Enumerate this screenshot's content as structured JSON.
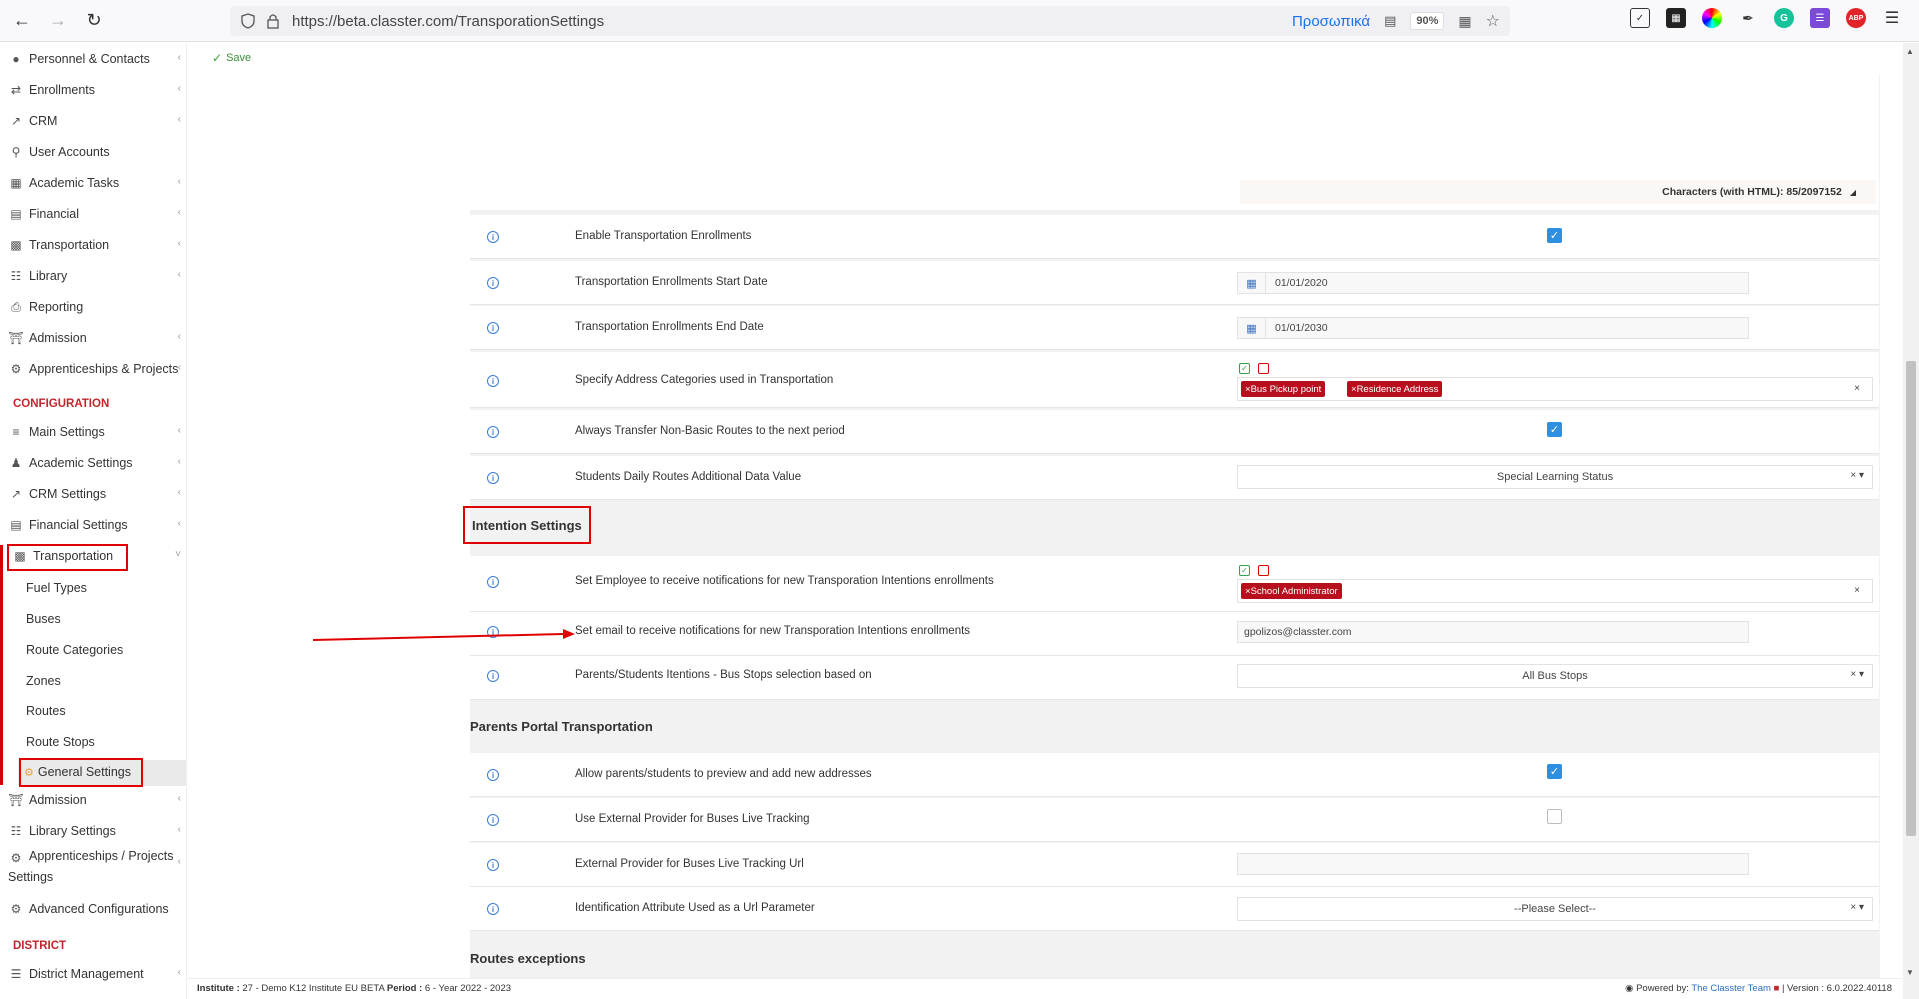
{
  "browser": {
    "url": "https://beta.classter.com/TransporationSettings",
    "profile_label": "Προσωπικά",
    "zoom": "90%"
  },
  "sidebar": {
    "items_top": [
      {
        "label": "Personnel & Contacts",
        "icon": "users-icon"
      },
      {
        "label": "Enrollments",
        "icon": "arrows-icon"
      },
      {
        "label": "CRM",
        "icon": "chart-icon"
      },
      {
        "label": "User Accounts",
        "icon": "key-icon"
      },
      {
        "label": "Academic Tasks",
        "icon": "grid-icon"
      },
      {
        "label": "Financial",
        "icon": "money-icon"
      },
      {
        "label": "Transportation",
        "icon": "bus-icon"
      },
      {
        "label": "Library",
        "icon": "books-icon"
      },
      {
        "label": "Reporting",
        "icon": "print-icon"
      },
      {
        "label": "Admission",
        "icon": "building-icon"
      },
      {
        "label": "Apprenticeships & Projects",
        "icon": "gear-icon"
      }
    ],
    "config_header": "CONFIGURATION",
    "items_config": [
      {
        "label": "Main Settings",
        "icon": "sliders-icon"
      },
      {
        "label": "Academic Settings",
        "icon": "people-icon"
      },
      {
        "label": "CRM Settings",
        "icon": "chart-icon"
      },
      {
        "label": "Financial Settings",
        "icon": "money-icon"
      }
    ],
    "transportation_label": "Transportation",
    "transport_sub": [
      "Fuel Types",
      "Buses",
      "Route Categories",
      "Zones",
      "Routes",
      "Route Stops"
    ],
    "general_settings": "General Settings",
    "items_after": [
      {
        "label": "Admission",
        "icon": "building-icon"
      },
      {
        "label": "Library Settings",
        "icon": "books-icon"
      }
    ],
    "apprenticeships_settings_line1": "Apprenticeships / Projects",
    "apprenticeships_settings_line2": "Settings",
    "advanced_config": "Advanced Configurations",
    "district_header": "DISTRICT",
    "district_mgmt": "District Management"
  },
  "toolbar": {
    "save_label": "Save"
  },
  "editor": {
    "char_counter": "Characters (with HTML): 85/2097152"
  },
  "rows": {
    "enable_enrollments": {
      "label": "Enable Transportation Enrollments",
      "checked": true
    },
    "start_date": {
      "label": "Transportation Enrollments Start Date",
      "value": "01/01/2020"
    },
    "end_date": {
      "label": "Transportation Enrollments End Date",
      "value": "01/01/2030"
    },
    "address_categories": {
      "label": "Specify Address Categories used in Transportation",
      "tags": [
        "Bus Pickup point",
        "Residence Address"
      ]
    },
    "transfer_routes": {
      "label": "Always Transfer Non-Basic Routes to the next period",
      "checked": true
    },
    "daily_routes_value": {
      "label": "Students Daily Routes Additional Data Value",
      "value": "Special Learning Status"
    }
  },
  "intention": {
    "title": "Intention Settings",
    "employee_notify": {
      "label": "Set Employee to receive notifications for new Transporation Intentions enrollments",
      "tags": [
        "School Administrator"
      ]
    },
    "email_notify": {
      "label": "Set email to receive notifications for new Transporation Intentions enrollments",
      "value": "gpolizos@classter.com"
    },
    "bus_stops": {
      "label": "Parents/Students Itentions - Bus Stops selection based on",
      "value": "All Bus Stops"
    }
  },
  "parents_portal": {
    "title": "Parents Portal Transportation",
    "preview_addresses": {
      "label": "Allow parents/students to preview and add new addresses",
      "checked": true
    },
    "external_provider": {
      "label": "Use External Provider for Buses Live Tracking",
      "checked": false
    },
    "external_url": {
      "label": "External Provider for Buses Live Tracking Url",
      "value": ""
    },
    "id_attribute": {
      "label": "Identification Attribute Used as a Url Parameter",
      "value": "--Please Select--"
    }
  },
  "routes_exceptions": {
    "title": "Routes exceptions"
  },
  "footer": {
    "institute_label": "Institute :",
    "institute_value": "27 - Demo K12 Institute EU BETA",
    "period_label": "Period :",
    "period_value": "6 - Year 2022 - 2023",
    "powered_by": "Powered by:",
    "team": "The Classter Team",
    "version": "| Version : 6.0.2022.40118"
  },
  "colors": {
    "accent_red": "#b80f1f",
    "checkbox_blue": "#2f8fe0",
    "annotation_red": "#e00000"
  }
}
